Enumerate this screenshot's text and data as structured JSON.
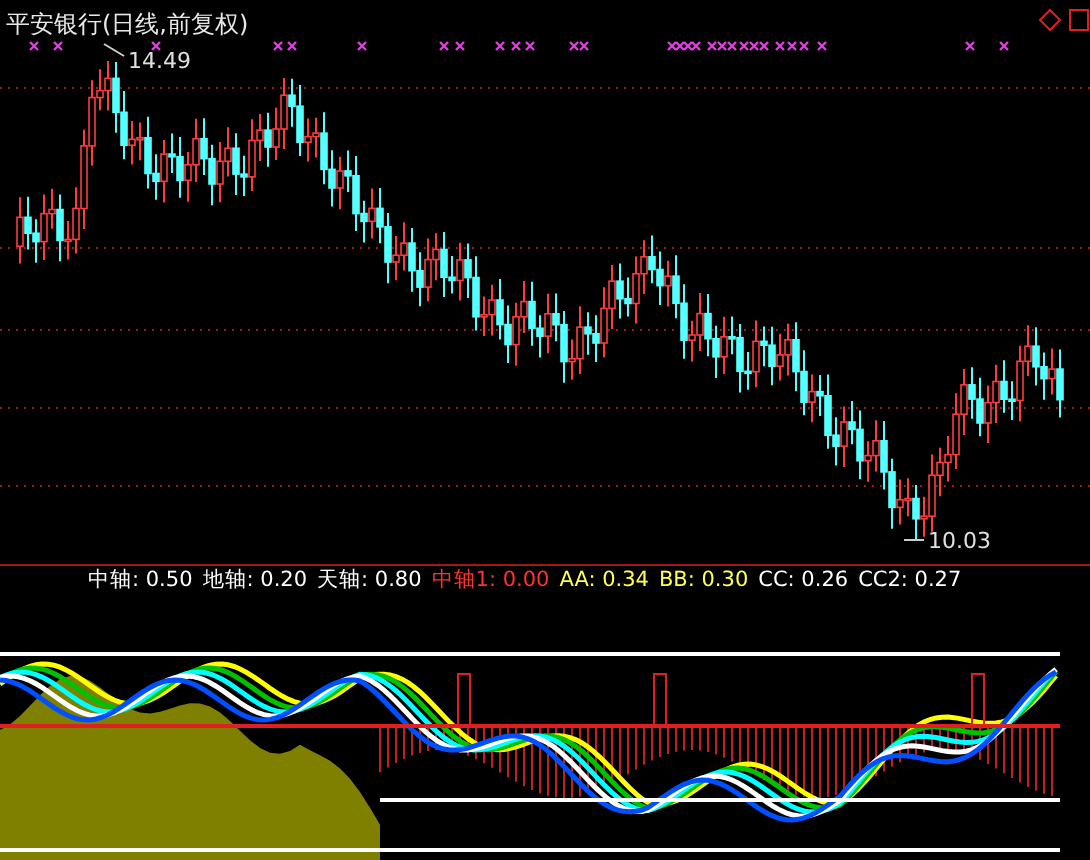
{
  "chart": {
    "title": "平安银行(日线,前复权)",
    "high_label": "14.49",
    "low_label": "10.03"
  },
  "indicator": {
    "values": [
      {
        "label": "中轴: 0.50",
        "color": "#ffffff"
      },
      {
        "label": "地轴: 0.20",
        "color": "#ffffff"
      },
      {
        "label": "天轴: 0.80",
        "color": "#ffffff"
      },
      {
        "label": "中轴1: 0.00",
        "color": "#ff3232"
      },
      {
        "label": "AA: 0.34",
        "color": "#ffff54"
      },
      {
        "label": "BB: 0.30",
        "color": "#ffff54"
      },
      {
        "label": "CC: 0.26",
        "color": "#ffffff"
      },
      {
        "label": "CC2: 0.27",
        "color": "#ffffff"
      }
    ]
  }
}
